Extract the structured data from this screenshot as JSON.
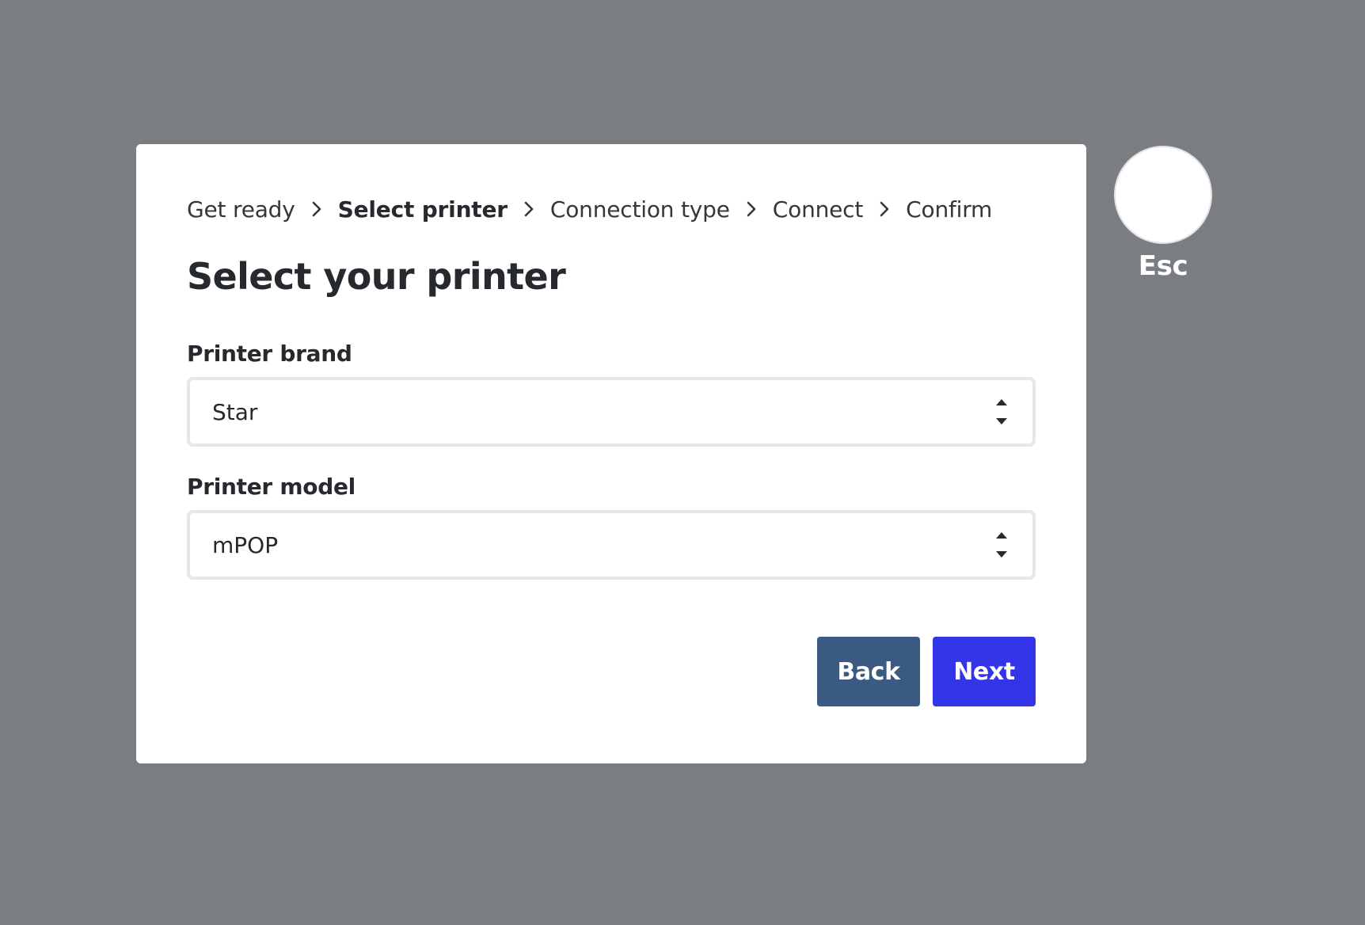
{
  "breadcrumb": {
    "steps": [
      {
        "label": "Get ready",
        "active": false
      },
      {
        "label": "Select printer",
        "active": true
      },
      {
        "label": "Connection type",
        "active": false
      },
      {
        "label": "Connect",
        "active": false
      },
      {
        "label": "Confirm",
        "active": false
      }
    ]
  },
  "page": {
    "title": "Select your printer"
  },
  "form": {
    "brand": {
      "label": "Printer brand",
      "value": "Star"
    },
    "model": {
      "label": "Printer model",
      "value": "mPOP"
    }
  },
  "actions": {
    "back_label": "Back",
    "next_label": "Next"
  },
  "esc": {
    "label": "Esc"
  },
  "colors": {
    "backdrop": "#7a7e83",
    "back_button": "#3a5a82",
    "next_button": "#3435e9"
  },
  "icons": {
    "breadcrumb_separator": "chevron-right-icon",
    "select_indicator": "up-down-arrows-icon"
  }
}
